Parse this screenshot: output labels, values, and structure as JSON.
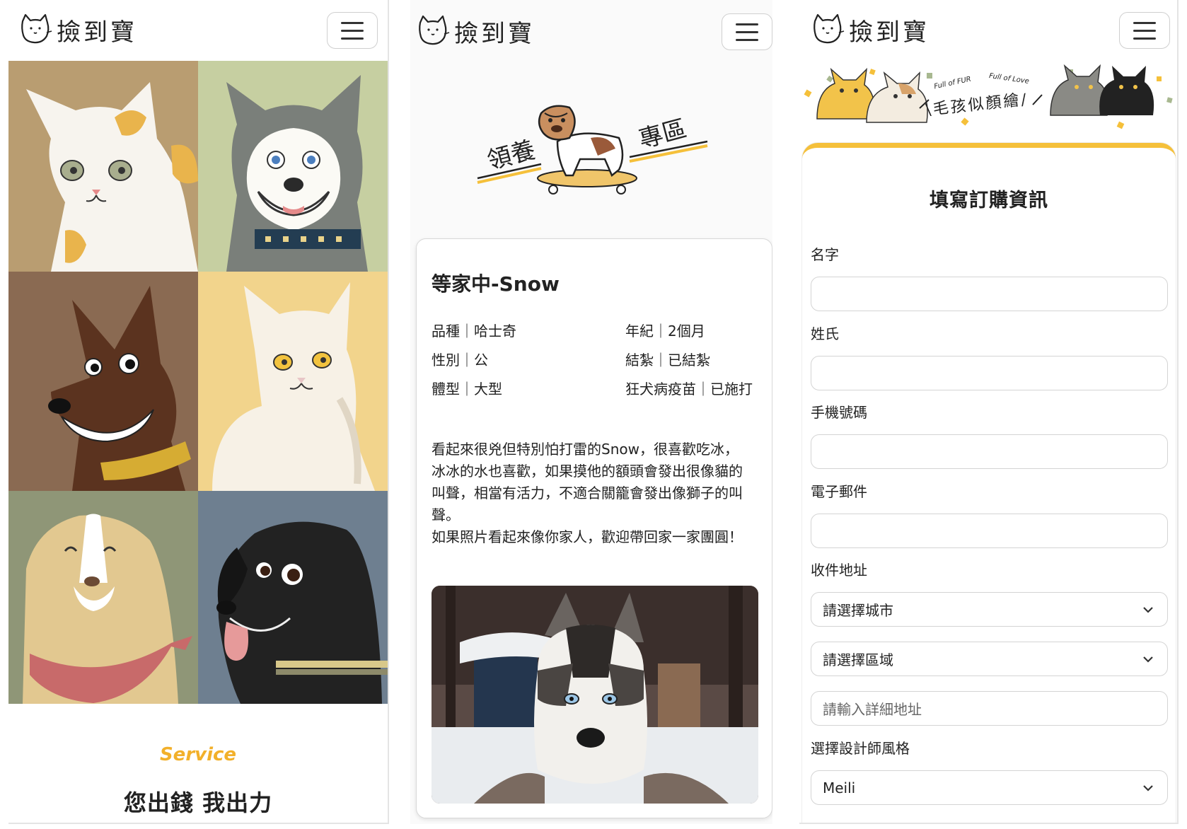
{
  "brand": {
    "name": "撿到寶"
  },
  "panel1": {
    "service_en": "Service",
    "service_zh": "您出錢 我出力"
  },
  "panel2": {
    "banner_left": "領養",
    "banner_right": "專區",
    "card": {
      "title": "等家中-Snow",
      "info": [
        "品種｜哈士奇",
        "年紀｜2個月",
        "性別｜公",
        "結紮｜已結紮",
        "體型｜大型",
        "狂犬病疫苗｜已施打"
      ],
      "desc_lines": [
        "看起來很兇但特別怕打雷的Snow，很喜歡吃冰，",
        "冰冰的水也喜歡，如果摸他的額頭會發出很像貓的",
        "叫聲，相當有活力，不適合關籠會發出像獅子的叫",
        "聲。",
        "如果照片看起來像你家人，歡迎帶回家一家團圓！"
      ]
    }
  },
  "panel3": {
    "banner_small_1": "Full of FUR",
    "banner_small_2": "Full of Love",
    "banner_text": "\\毛孩似顏繪/",
    "form_title": "填寫訂購資訊",
    "labels": {
      "name": "名字",
      "surname": "姓氏",
      "phone": "手機號碼",
      "email": "電子郵件",
      "address": "收件地址",
      "style": "選擇設計師風格"
    },
    "city_select": "請選擇城市",
    "district_select": "請選擇區域",
    "address_placeholder": "請輸入詳細地址",
    "style_select": "Meili"
  },
  "colors": {
    "accent": "#f2b02a",
    "form_top_border": "#f5c03a"
  }
}
